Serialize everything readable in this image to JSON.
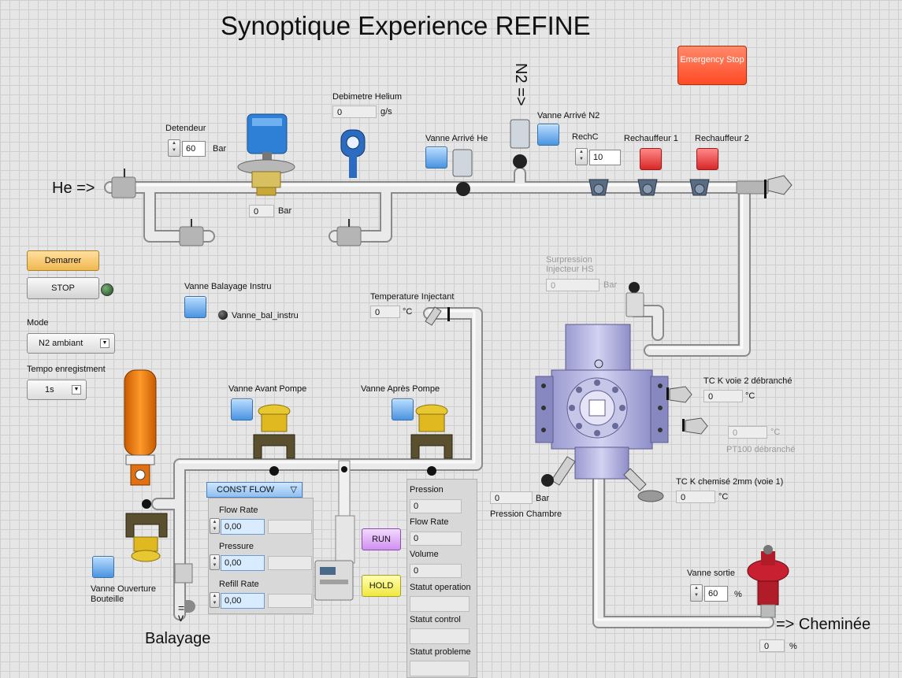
{
  "title": "Synoptique Experience REFINE",
  "emergency_stop": "Emergency Stop",
  "flow_labels": {
    "he": "He =>",
    "n2": "N2 =>",
    "balayage": "Balayage",
    "cheminee": "=> Cheminée"
  },
  "detendeur": {
    "label": "Detendeur",
    "value": "60",
    "unit": "Bar",
    "pressure_value": "0",
    "pressure_unit": "Bar"
  },
  "debimetre": {
    "label": "Debimetre Helium",
    "value": "0",
    "unit": "g/s"
  },
  "vanne_arrive_he": {
    "label": "Vanne Arrivé He"
  },
  "vanne_arrive_n2": {
    "label": "Vanne Arrivé N2"
  },
  "rechc": {
    "label": "RechC",
    "value": "10"
  },
  "rechauffeur1": {
    "label": "Rechauffeur 1"
  },
  "rechauffeur2": {
    "label": "Rechauffeur 2"
  },
  "controls": {
    "demarrer": "Demarrer",
    "stop": "STOP",
    "mode_label": "Mode",
    "mode_value": "N2 ambiant",
    "tempo_label": "Tempo enregistment",
    "tempo_value": "1s"
  },
  "vanne_balayage": {
    "label": "Vanne Balayage Instru",
    "indicator": "Vanne_bal_instru"
  },
  "temp_injectant": {
    "label": "Temperature Injectant",
    "value": "0",
    "unit": "°C"
  },
  "surpression": {
    "label": "Surpression Injecteur HS",
    "value": "0",
    "unit": "Bar"
  },
  "tc_voie2": {
    "label": "TC K voie 2 débranché",
    "value": "0",
    "unit": "°C"
  },
  "pt100": {
    "label": "PT100 débranché",
    "value": "0",
    "unit": "°C"
  },
  "tc_chemise": {
    "label": "TC K chemisé 2mm (voie 1)",
    "value": "0",
    "unit": "°C"
  },
  "pression_chambre": {
    "label": "Pression Chambre",
    "value": "0",
    "unit": "Bar"
  },
  "vanne_avant_pompe": {
    "label": "Vanne Avant Pompe"
  },
  "vanne_apres_pompe": {
    "label": "Vanne Après Pompe"
  },
  "vanne_ouverture": {
    "label": "Vanne Ouverture Bouteille"
  },
  "pump": {
    "mode": "CONST FLOW",
    "flow_rate_label": "Flow Rate",
    "flow_rate_value": "0,00",
    "pressure_label": "Pressure",
    "pressure_value": "0,00",
    "refill_rate_label": "Refill Rate",
    "refill_rate_value": "0,00",
    "run": "RUN",
    "hold": "HOLD"
  },
  "status": {
    "pression_label": "Pression",
    "pression_value": "0",
    "flow_rate_label": "Flow Rate",
    "flow_rate_value": "0",
    "volume_label": "Volume",
    "volume_value": "0",
    "statut_operation": "Statut operation",
    "statut_control": "Statut control",
    "statut_probleme": "Statut probleme"
  },
  "vanne_sortie": {
    "label": "Vanne sortie",
    "value": "60",
    "unit": "%",
    "pct_value": "0",
    "pct_unit": "%"
  },
  "colors": {
    "accent_blue": "#4a94e0",
    "alarm_red": "#d82828",
    "emergency": "#ff5a36",
    "pipe": "#cfcfcf"
  }
}
